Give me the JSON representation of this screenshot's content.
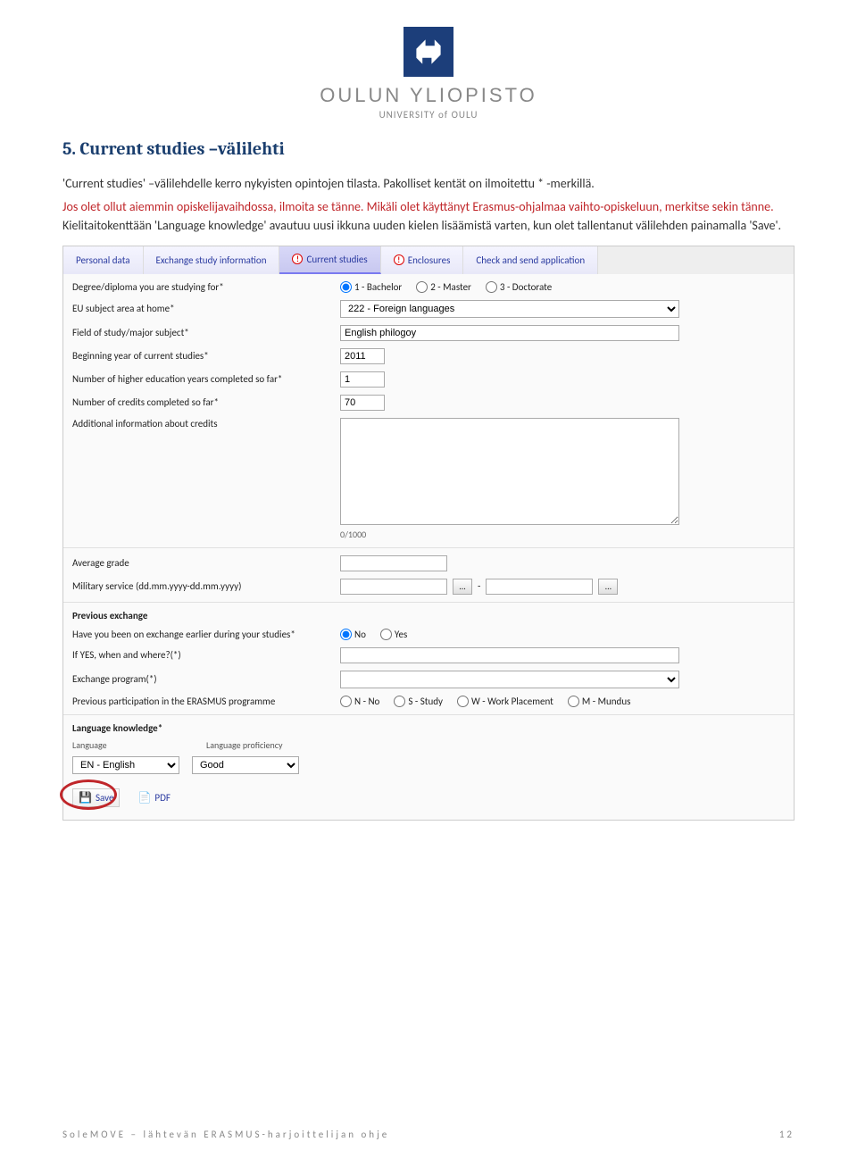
{
  "university": {
    "name_fi": "OULUN YLIOPISTO",
    "name_en": "UNIVERSITY of OULU"
  },
  "title": "5. Current studies –välilehti",
  "para1": "'Current studies' –välilehdelle kerro nykyisten opintojen tilasta. Pakolliset kentät on ilmoitettu * -merkillä.",
  "para2_a": "Jos olet ollut aiemmin opiskelijavaihdossa, ilmoita se tänne. Mikäli olet käyttänyt Erasmus-ohjalmaa vaihto-opiskeluun, merkitse sekin tänne.",
  "para2_b": " Kielitaitokenttään 'Language knowledge' avautuu uusi ikkuna uuden kielen lisäämistä varten, kun olet tallentanut  välilehden painamalla 'Save'.",
  "tabs": {
    "personal": "Personal data",
    "exchange": "Exchange study information",
    "current": "Current studies",
    "enclosures": "Enclosures",
    "check": "Check and send application"
  },
  "labels": {
    "degree": "Degree/diploma you are studying for*",
    "eu_subject": "EU subject area at home*",
    "field": "Field of study/major subject*",
    "begin_year": "Beginning year of current studies*",
    "years_completed": "Number of higher education years completed so far*",
    "credits": "Number of credits completed so far*",
    "addinfo": "Additional information about credits",
    "avg": "Average grade",
    "military": "Military service (dd.mm.yyyy-dd.mm.yyyy)",
    "prev_exch_head": "Previous exchange",
    "been_exchange": "Have you been on exchange earlier during your studies*",
    "when_where": "If YES, when and where?(*)",
    "program": "Exchange program(*)",
    "erasmus": "Previous participation in the ERASMUS programme",
    "lang_head": "Language knowledge*",
    "lang_col1": "Language",
    "lang_col2": "Language proficiency"
  },
  "values": {
    "degree_options": {
      "b": "1 - Bachelor",
      "m": "2 - Master",
      "d": "3 - Doctorate"
    },
    "eu_subject": "222 - Foreign languages",
    "field": "English philogoy",
    "begin_year": "2011",
    "years_completed": "1",
    "credits": "70",
    "counter": "0/1000",
    "military_sep": "-",
    "no": "No",
    "yes": "Yes",
    "erasmus_opts": {
      "n": "N - No",
      "s": "S - Study",
      "w": "W - Work Placement",
      "m": "M - Mundus"
    },
    "lang": "EN - English",
    "prof": "Good",
    "save": "Save",
    "pdf": "PDF",
    "picker": "..."
  },
  "footer": {
    "left": "SoleMOVE – lähtevän ERASMUS-harjoittelijan ohje",
    "page": "12"
  }
}
